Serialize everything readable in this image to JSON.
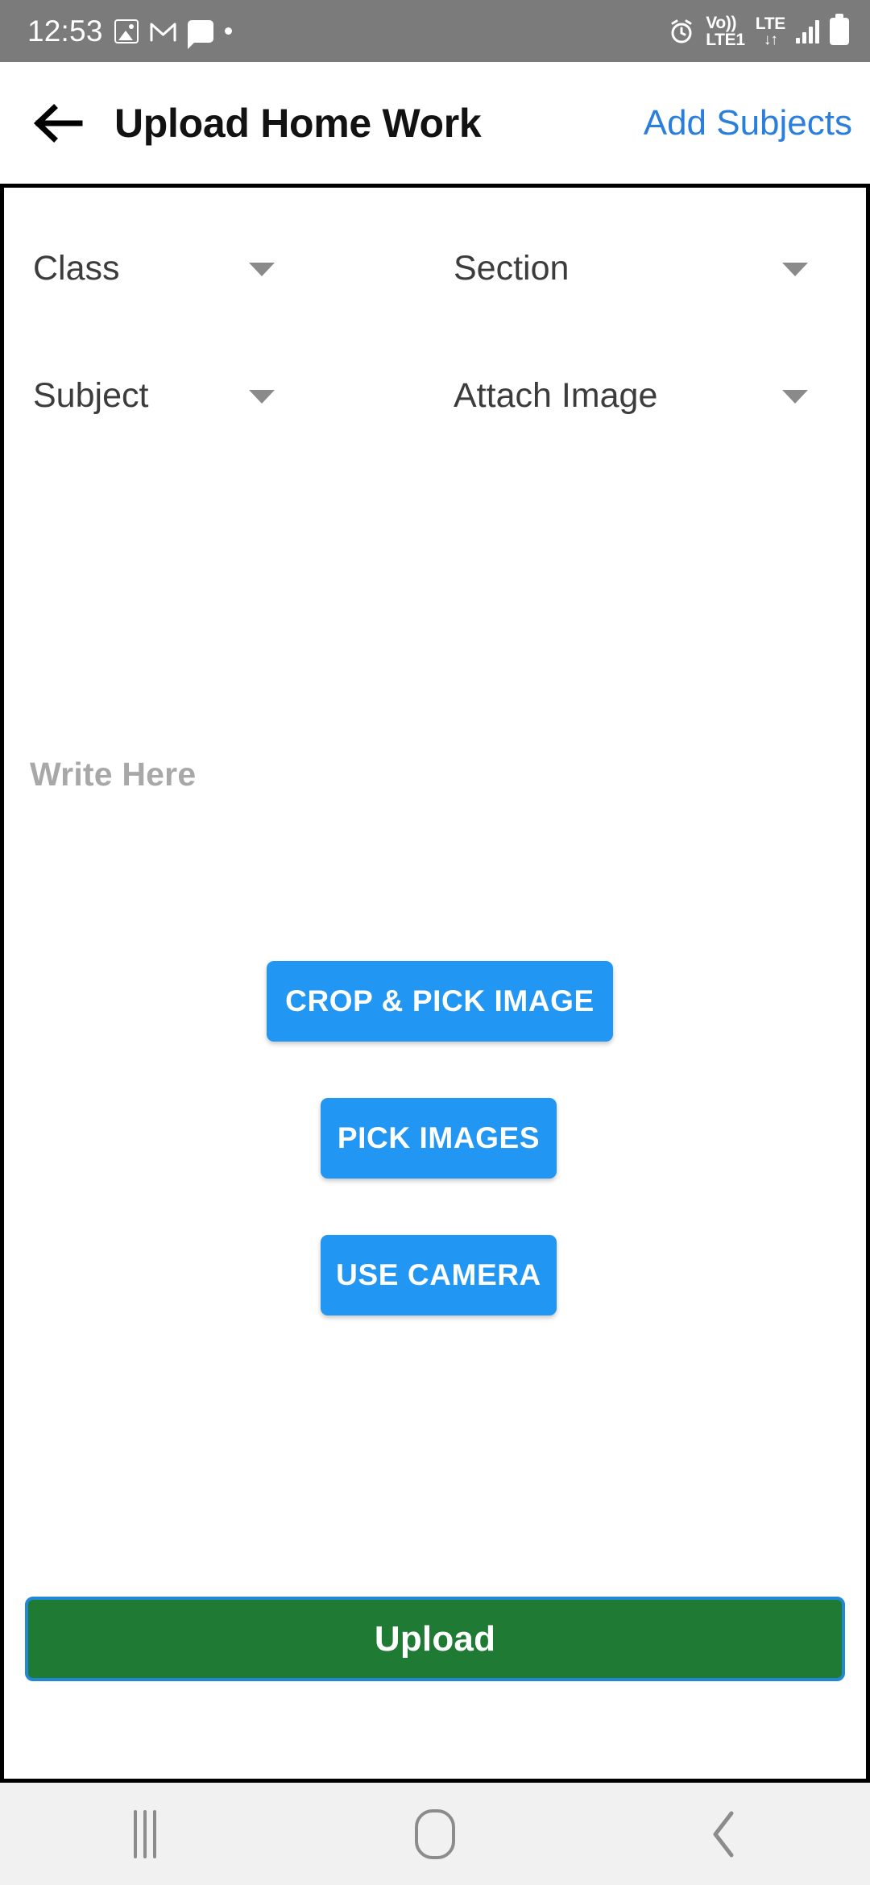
{
  "status_bar": {
    "time": "12:53",
    "icons_left": [
      "photos-icon",
      "gmail-icon",
      "chat-bubble-icon",
      "dot-icon"
    ],
    "volte_line1": "Vo))",
    "volte_line2": "LTE1",
    "lte_label": "LTE",
    "data_arrows": "↓↑",
    "icons_right": [
      "alarm-icon",
      "volte-icon",
      "lte-icon",
      "signal-icon",
      "battery-icon"
    ],
    "background_color": "#7b7b7b"
  },
  "appbar": {
    "back_icon": "arrow-left-icon",
    "title": "Upload Home Work",
    "action_label": "Add Subjects",
    "action_color": "#2a7fdd"
  },
  "form": {
    "dropdowns": [
      {
        "label": "Class",
        "caret": "chevron-down-icon"
      },
      {
        "label": "Section",
        "caret": "chevron-down-icon"
      },
      {
        "label": "Subject",
        "caret": "chevron-down-icon"
      },
      {
        "label": "Attach Image",
        "caret": "chevron-down-icon"
      }
    ],
    "note_placeholder": "Write Here"
  },
  "actions": {
    "crop_pick_label": "CROP & PICK IMAGE",
    "pick_images_label": "PICK IMAGES",
    "use_camera_label": "USE CAMERA",
    "upload_label": "Upload",
    "button_color": "#2196f3",
    "upload_color": "#1f7a33",
    "upload_border_color": "#2188d6"
  },
  "navbar": {
    "recents": "recents-icon",
    "home": "home-icon",
    "back": "back-icon"
  }
}
